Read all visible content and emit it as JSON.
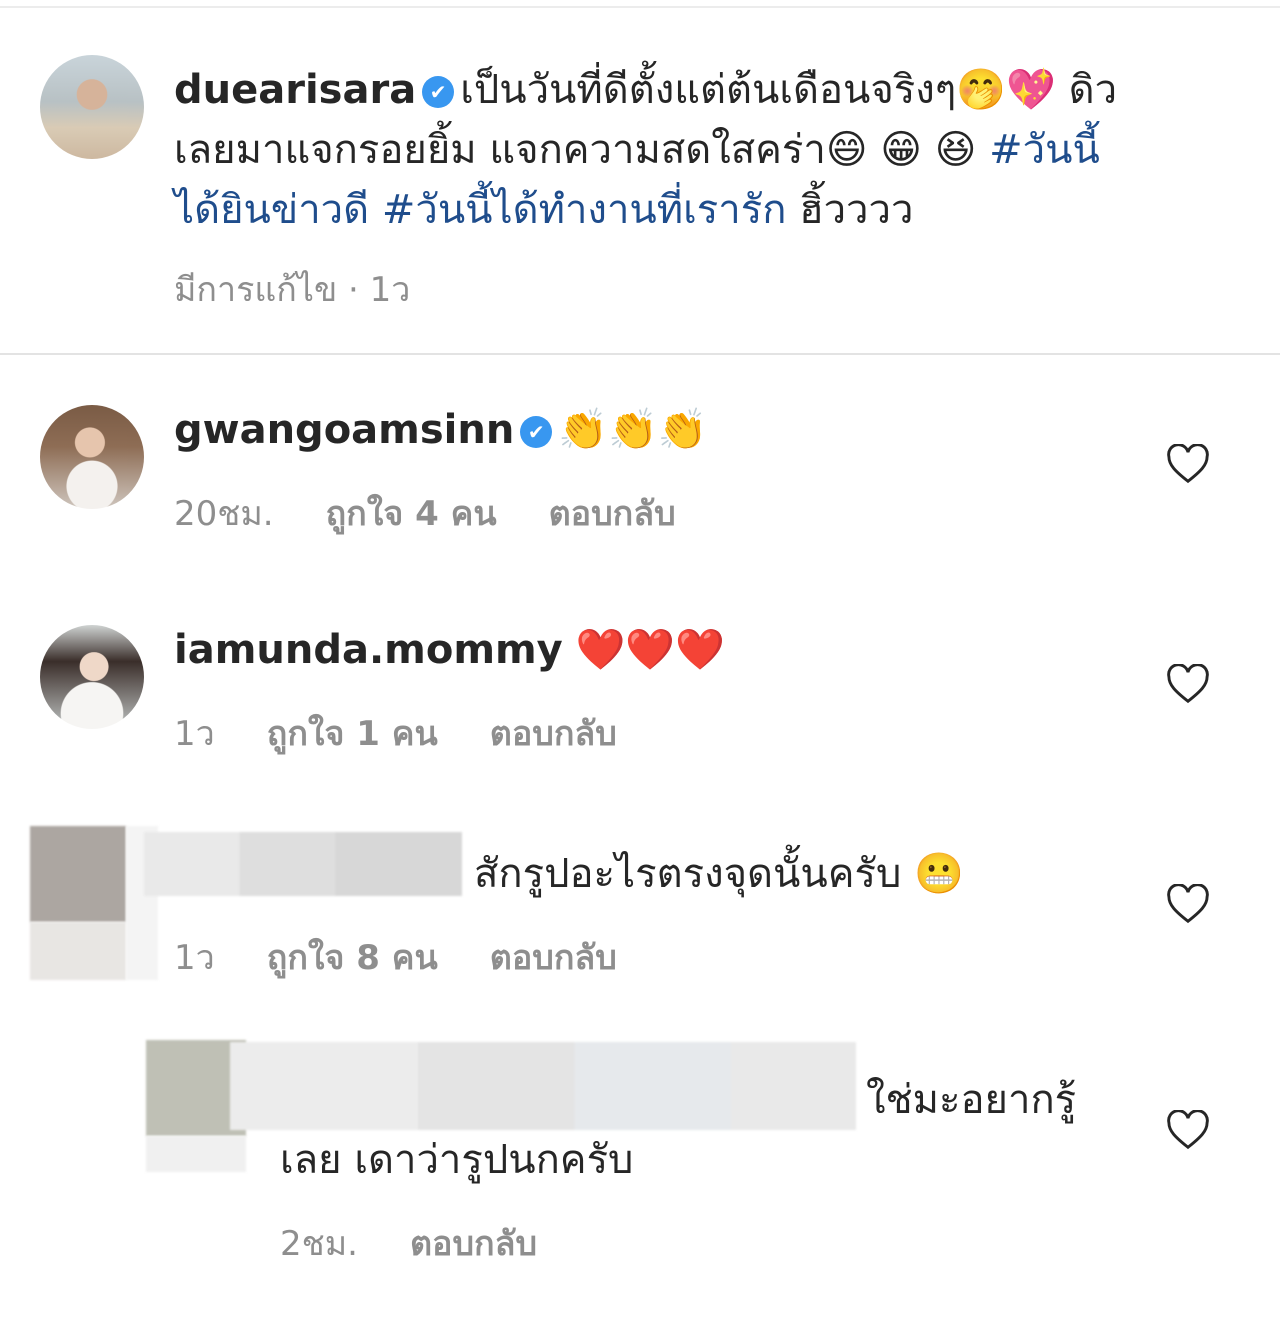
{
  "post": {
    "username": "duearisara",
    "caption_line1": "เป็นวันที่ดีตั้งแต่ต้นเดือนจริงๆ🤭💖 ดิว",
    "caption_line2": "เลยมาแจกรอยยิ้ม แจกความสดใสคร่า😄 😁 😆 ",
    "hashtag1": "#วันนี้",
    "hashtag1_cont": "ได้ยินข่าวดี",
    "hashtag2": "#วันนี้ได้ทำงานที่เรารัก",
    "caption_tail": "ฮิ้วววว",
    "edited": "มีการแก้ไข · 1ว"
  },
  "comments": [
    {
      "username": "gwangoamsinn",
      "text": "👏👏👏",
      "time": "20ชม.",
      "likes": "ถูกใจ 4 คน",
      "reply": "ตอบกลับ",
      "verified": true
    },
    {
      "username": "iamunda.mommy",
      "text": "❤️❤️❤️",
      "time": "1ว",
      "likes": "ถูกใจ 1 คน",
      "reply": "ตอบกลับ"
    },
    {
      "text": "สักรูปอะไรตรงจุดนั้นครับ 😬",
      "time": "1ว",
      "likes": "ถูกใจ 8 คน",
      "reply": "ตอบกลับ"
    },
    {
      "text_line1": "ใช่มะอยากรู้",
      "text_line2": "เลย เดาว่ารูปนกครับ",
      "time": "2ชม.",
      "reply": "ตอบกลับ"
    }
  ],
  "icons": {
    "verified": "verified-badge-icon",
    "like": "heart-outline-icon"
  },
  "colors": {
    "text": "#262626",
    "meta": "#8e8e8e",
    "hashtag": "#1f4d8c",
    "verified": "#3897f0"
  }
}
